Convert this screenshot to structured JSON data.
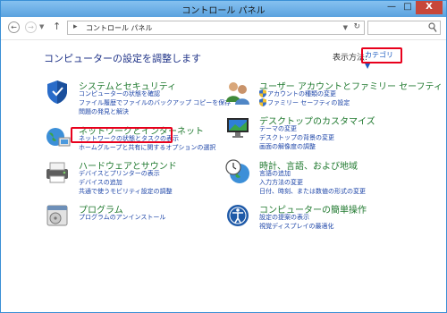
{
  "window": {
    "title": "コントロール パネル",
    "min_label": "—",
    "max_label": "□",
    "close_label": "X"
  },
  "nav": {
    "back_glyph": "←",
    "forward_glyph": "→",
    "recent_glyph": "▼",
    "up_glyph": "↑",
    "crumb_sep": "▸",
    "breadcrumb": "コントロール パネル",
    "address_dropdown": "▼",
    "refresh_glyph": "↻"
  },
  "content": {
    "heading": "コンピューターの設定を調整します",
    "view_by_label": "表示方法:",
    "view_by_value": "カテゴリ ▼"
  },
  "categories": {
    "system": {
      "title": "システムとセキュリティ",
      "links": [
        "コンピューターの状態を確認",
        "ファイル履歴でファイルのバックアップ コピーを保存",
        "問題の発見と解決"
      ],
      "icon": "shield-icon"
    },
    "network": {
      "title": "ネットワークとインターネット",
      "links": [
        "ネットワークの状態とタスクの表示",
        "ホームグループと共有に関するオプションの選択"
      ],
      "icon": "globe-network-icon"
    },
    "hardware": {
      "title": "ハードウェアとサウンド",
      "links": [
        "デバイスとプリンターの表示",
        "デバイスの追加",
        "共通で使うモビリティ設定の調整"
      ],
      "icon": "printer-icon"
    },
    "programs": {
      "title": "プログラム",
      "links": [
        "プログラムのアンインストール"
      ],
      "icon": "programs-icon"
    },
    "users": {
      "title": "ユーザー アカウントとファミリー セーフティ",
      "links": [
        "アカウントの種類の変更",
        "ファミリー セーフティの設定"
      ],
      "icon": "users-icon"
    },
    "appearance": {
      "title": "デスクトップのカスタマイズ",
      "links": [
        "テーマの変更",
        "デスクトップの背景の変更",
        "画面の解像度の調整"
      ],
      "icon": "monitor-icon"
    },
    "clock": {
      "title": "時計、言語、および地域",
      "links": [
        "言語の追加",
        "入力方法の変更",
        "日付、時刻、または数値の形式の変更"
      ],
      "icon": "clock-globe-icon"
    },
    "ease": {
      "title": "コンピューターの簡単操作",
      "links": [
        "設定の提案の表示",
        "視覚ディスプレイの最適化"
      ],
      "icon": "ease-of-access-icon"
    }
  },
  "colors": {
    "highlight": "#e8001c",
    "link": "#1d45a8",
    "category_title": "#217a30",
    "heading": "#1e3287"
  }
}
